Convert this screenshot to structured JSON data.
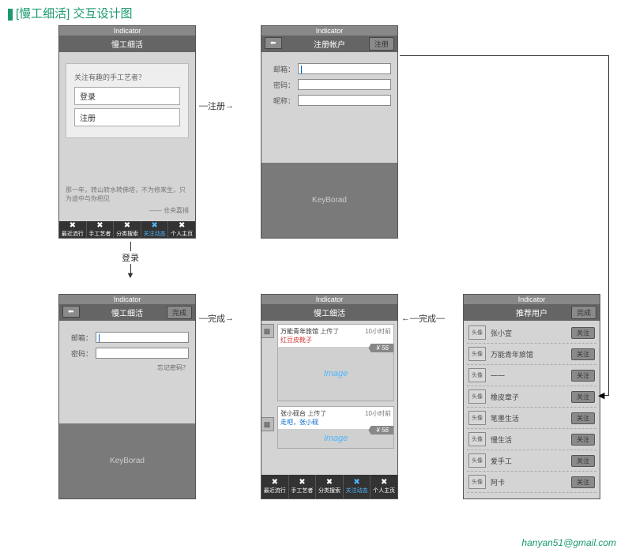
{
  "page": {
    "title": "[慢工细活] 交互设计图",
    "footer_email": "hanyan51@gmail.com"
  },
  "common": {
    "indicator": "Indicator",
    "keyboard": "KeyBorad",
    "image_placeholder": "Image",
    "avatar_label": "头像"
  },
  "tabs": [
    "最近流行",
    "手工艺者",
    "分类搜索",
    "关注动态",
    "个人主页"
  ],
  "flow_labels": {
    "register": "注册",
    "login": "登录",
    "done": "完成"
  },
  "screens": {
    "welcome": {
      "title": "慢工细活",
      "prompt": "关注有趣的手工艺者？",
      "login_btn": "登录",
      "register_btn": "注册",
      "quote": "那一年，转山转水转佛塔，不为修来生，只为途中与你相见",
      "quote_author": "—— 仓央嘉措"
    },
    "register": {
      "title": "注册帐户",
      "action": "注册",
      "fields": {
        "email": "邮箱：",
        "password": "密码：",
        "nickname": "昵称："
      }
    },
    "login_form": {
      "title": "慢工细活",
      "action": "完成",
      "fields": {
        "email": "邮箱：",
        "password": "密码："
      },
      "forgot": "忘记密码？"
    },
    "feed": {
      "title": "慢工细活",
      "items": [
        {
          "name": "万能青年旅馆",
          "act": "上传了",
          "time": "10小时前",
          "work": "红豆皮靴子",
          "price": "¥ 56"
        },
        {
          "name": "张小砚台",
          "act": "上传了",
          "time": "10小时前",
          "work": "走吧，张小砚",
          "price": "¥ 56"
        }
      ]
    },
    "recommend": {
      "title": "推荐用户",
      "action": "完成",
      "follow_btn": "关注",
      "users": [
        "张小宣",
        "万能青年旅馆",
        "一一",
        "橡皮章子",
        "笔墨生活",
        "慢生活",
        "爱手工",
        "阿卡"
      ]
    }
  }
}
